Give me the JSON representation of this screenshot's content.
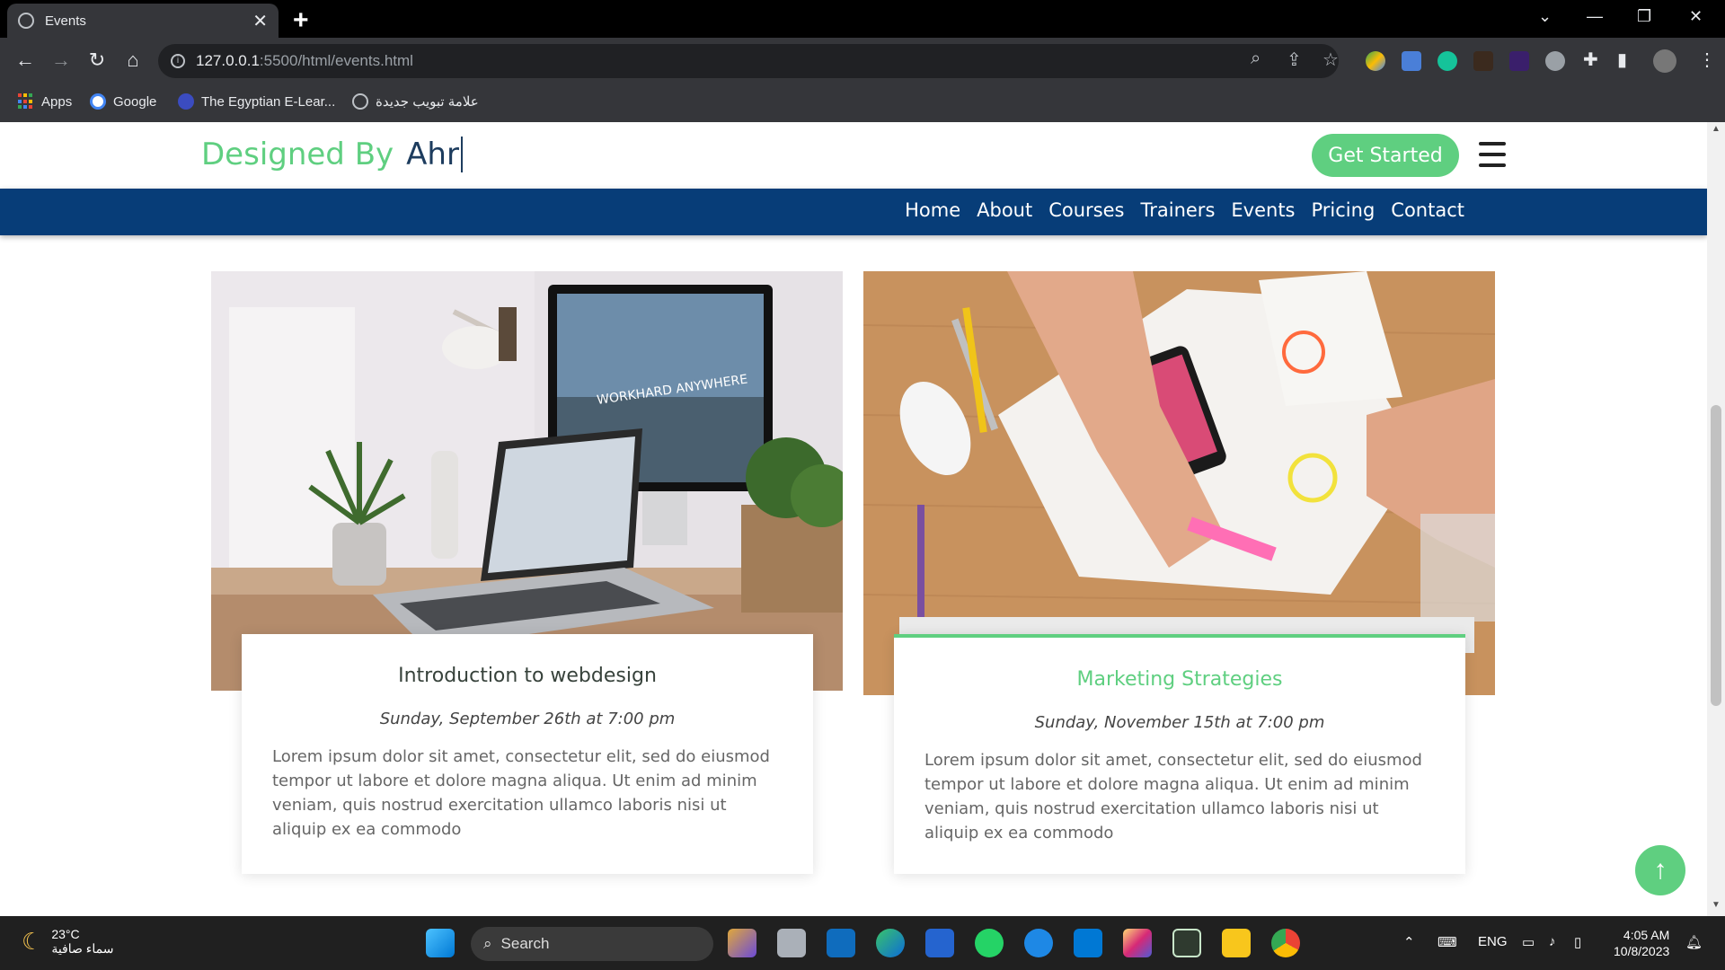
{
  "browser": {
    "tab_title": "Events",
    "url_host": "127.0.0.1",
    "url_path": ":5500/html/events.html",
    "bookmarks": [
      {
        "label": "Apps",
        "icon": "apps-grid-icon"
      },
      {
        "label": "Google",
        "icon": "google-icon"
      },
      {
        "label": "The Egyptian E-Lear...",
        "icon": "globe-icon"
      },
      {
        "label": "علامة تبويب جديدة",
        "icon": "globe-icon"
      }
    ]
  },
  "site": {
    "logo_green": "Designed By",
    "logo_navy": "Ahr",
    "get_started": "Get Started",
    "nav": [
      "Home",
      "About",
      "Courses",
      "Trainers",
      "Events",
      "Pricing",
      "Contact"
    ],
    "accent": "#5fcf80",
    "navy": "#073d78"
  },
  "events": [
    {
      "title": "Introduction to webdesign",
      "date": "Sunday, September 26th at 7:00 pm",
      "description": "Lorem ipsum dolor sit amet, consectetur elit, sed do eiusmod tempor ut labore et dolore magna aliqua. Ut enim ad minim veniam, quis nostrud exercitation ullamco laboris nisi ut aliquip ex ea commodo",
      "image_alt": "desk with laptop and monitor"
    },
    {
      "title": "Marketing Strategies",
      "date": "Sunday, November 15th at 7:00 pm",
      "description": "Lorem ipsum dolor sit amet, consectetur elit, sed do eiusmod tempor ut labore et dolore magna aliqua. Ut enim ad minim veniam, quis nostrud exercitation ullamco laboris nisi ut aliquip ex ea commodo",
      "image_alt": "hands sketching wireframes on desk"
    }
  ],
  "image_text": "WORKHARD ANYWHERE",
  "taskbar": {
    "temperature": "23°C",
    "weather": "سماء صافية",
    "search_label": "Search",
    "language": "ENG",
    "time": "4:05 AM",
    "date": "10/8/2023"
  }
}
